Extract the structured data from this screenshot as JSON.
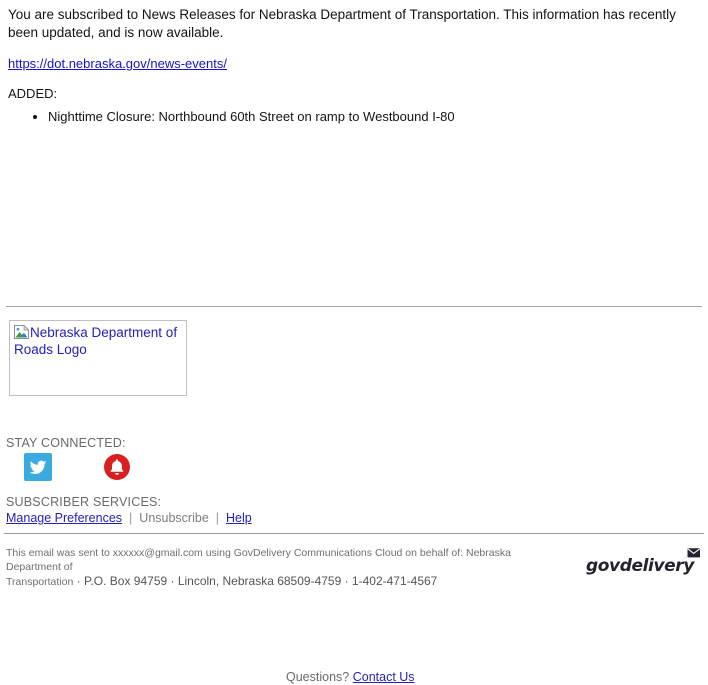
{
  "message": {
    "intro": "You are subscribed to News Releases for Nebraska Department of Transportation. This information has recently been updated, and is now available.",
    "url_text": "https://dot.nebraska.gov/news-events/",
    "added_label": "ADDED:",
    "added_items": [
      "Nighttime Closure: Northbound 60th Street on ramp to Westbound I-80"
    ]
  },
  "logo": {
    "alt_text": "Nebraska Department of Roads Logo",
    "icon": "broken-image-icon"
  },
  "contact": {
    "question_text": "Questions?",
    "link_label": "Contact Us"
  },
  "stay_connected": {
    "label": "STAY CONNECTED:",
    "icons": [
      {
        "name": "twitter-icon",
        "color": "#3aaae1"
      },
      {
        "name": "govdelivery-bell-icon",
        "color": "#d91f1f"
      }
    ]
  },
  "subscriber_services": {
    "label": "SUBSCRIBER SERVICES:",
    "manage_label": "Manage Preferences",
    "unsubscribe_label": "Unsubscribe",
    "help_label": "Help",
    "separator": "|"
  },
  "footer": {
    "line1": "This email was sent to xxxxxx@gmail.com using GovDelivery Communications Cloud on behalf of: Nebraska Department of",
    "line2_lead": "Transportation",
    "line2_rest": "· P.O. Box 94759 · Lincoln, Nebraska 68509-4759 · 1-402-471-4567",
    "brand": "govdelivery"
  },
  "colors": {
    "link": "#2222bb",
    "muted_text": "#6a6a6a",
    "twitter_blue": "#3aaae1",
    "bell_red": "#d91f1f",
    "brand_navy": "#22232e"
  }
}
